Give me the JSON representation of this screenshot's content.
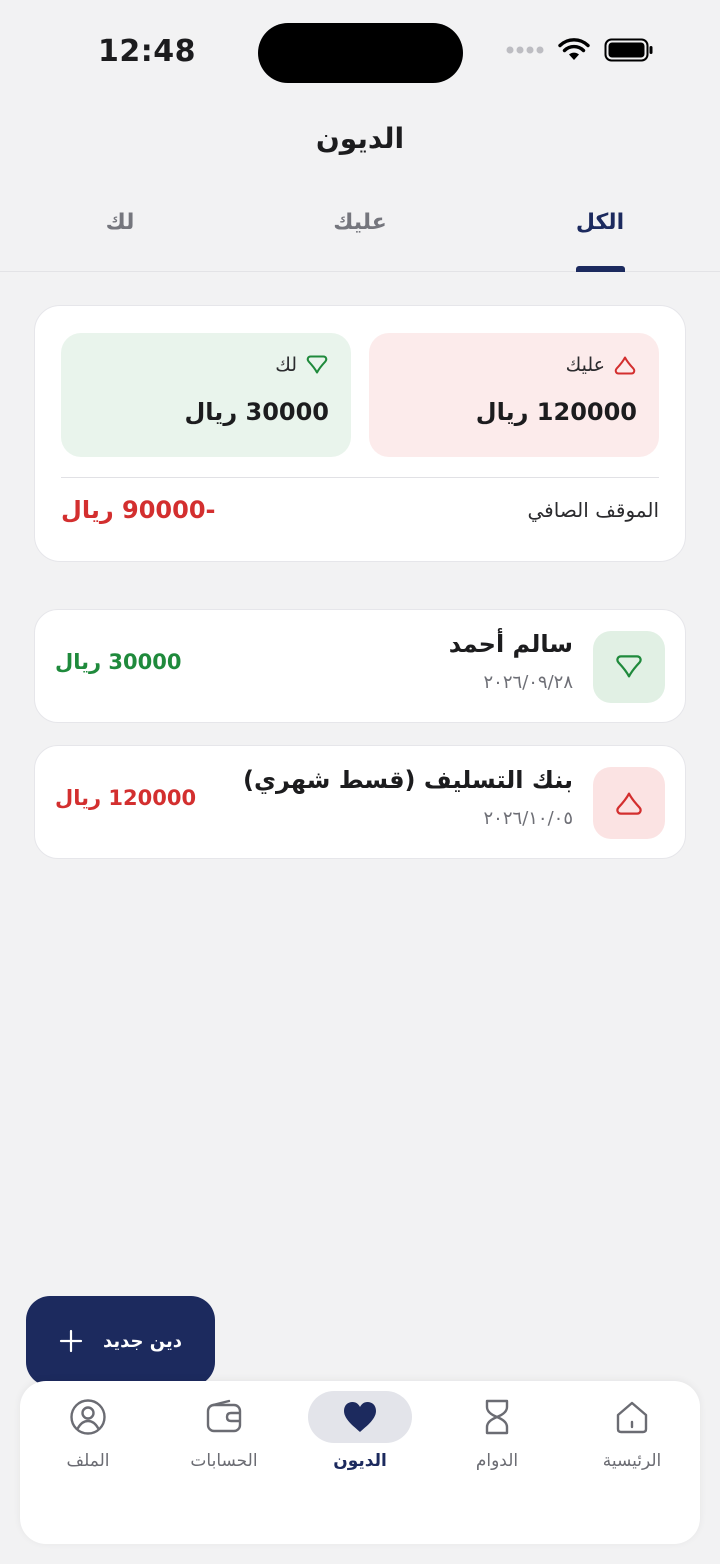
{
  "status": {
    "time": "12:48"
  },
  "header": {
    "title": "الديون"
  },
  "tabs": [
    {
      "label": "الكل",
      "active": true
    },
    {
      "label": "عليك",
      "active": false
    },
    {
      "label": "لك",
      "active": false
    }
  ],
  "summary": {
    "owe": {
      "label": "عليك",
      "amount": "120000 ريال"
    },
    "owed": {
      "label": "لك",
      "amount": "30000 ريال"
    },
    "net_label": "الموقف الصافي",
    "net_value": "-90000 ريال"
  },
  "debts": [
    {
      "name": "سالم أحمد",
      "date": "٢٠٢٦/٠٩/٢٨",
      "amount": "30000 ريال",
      "direction": "owed",
      "icon": "heart-outline-icon"
    },
    {
      "name": "بنك التسليف (قسط شهري)",
      "date": "٢٠٢٦/١٠/٠٥",
      "amount": "120000 ريال",
      "direction": "owe",
      "icon": "heart-outline-icon"
    }
  ],
  "fab": {
    "label": "دين جديد",
    "icon": "plus-icon"
  },
  "nav": [
    {
      "label": "الرئيسية",
      "icon": "home-icon",
      "active": false
    },
    {
      "label": "الدوام",
      "icon": "hourglass-icon",
      "active": false
    },
    {
      "label": "الديون",
      "icon": "heart-icon",
      "active": true
    },
    {
      "label": "الحسابات",
      "icon": "wallet-icon",
      "active": false
    },
    {
      "label": "الملف",
      "icon": "user-icon",
      "active": false
    }
  ],
  "colors": {
    "primary": "#1c2a5e",
    "positive": "#1f8a3c",
    "negative": "#d32f2f",
    "owe_bg": "#fcebeb",
    "owed_bg": "#e9f4ec"
  }
}
